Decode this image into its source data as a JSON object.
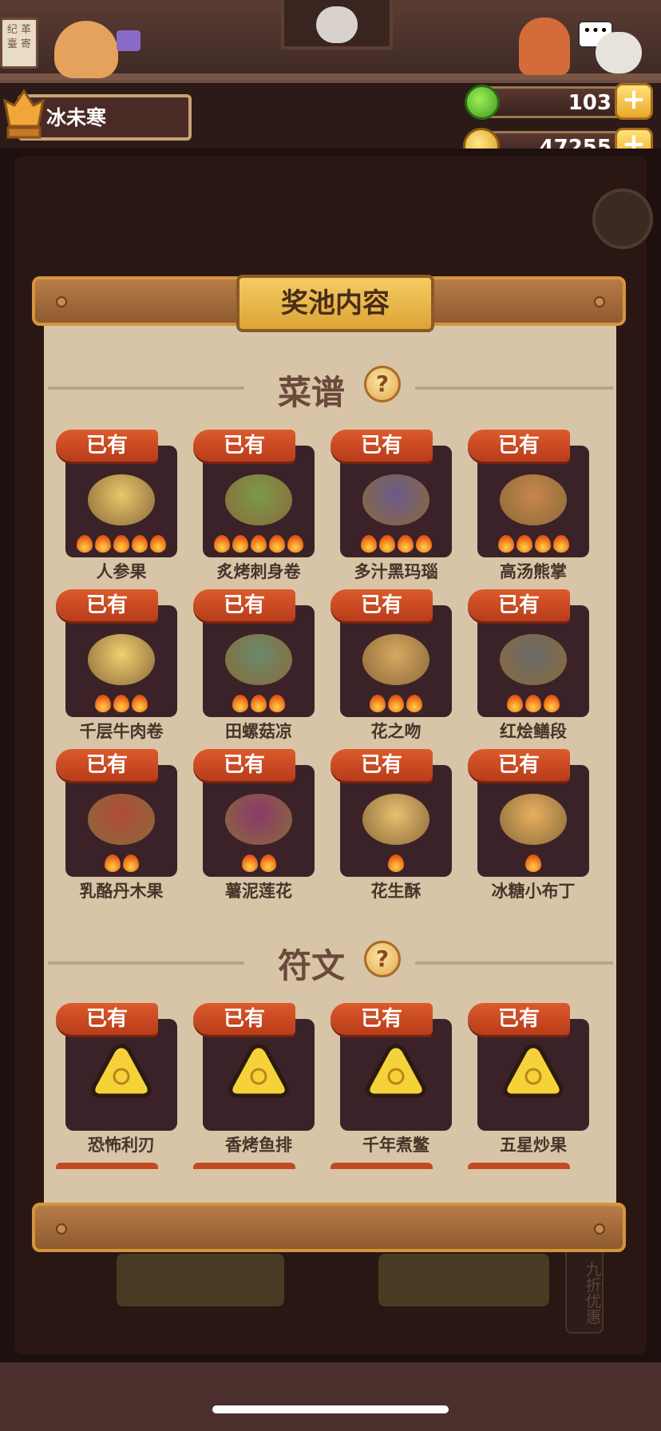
{
  "top_scene": {
    "sign_left": "纪 革\n臺 寄"
  },
  "player": {
    "name": "冰未寒"
  },
  "currency": {
    "gems": "103",
    "coins": "47255",
    "plus": "+"
  },
  "modal": {
    "title": "奖池内容",
    "owned_label": "已有",
    "question_mark": "?",
    "recipes_title": "菜谱",
    "runes_title": "符文",
    "recipes": [
      {
        "name": "人参果",
        "stars": 5,
        "art": "ginseng-fruit-icon"
      },
      {
        "name": "炙烤刺身卷",
        "stars": 5,
        "art": "grilled-roll-icon"
      },
      {
        "name": "多汁黑玛瑙",
        "stars": 4,
        "art": "black-agate-icon"
      },
      {
        "name": "高汤熊掌",
        "stars": 4,
        "art": "bear-paw-icon"
      },
      {
        "name": "千层牛肉卷",
        "stars": 3,
        "art": "beef-roll-icon"
      },
      {
        "name": "田螺菇凉",
        "stars": 3,
        "art": "snail-mushroom-icon"
      },
      {
        "name": "花之吻",
        "stars": 3,
        "art": "flower-kiss-icon"
      },
      {
        "name": "红烩鳝段",
        "stars": 3,
        "art": "eel-stew-icon"
      },
      {
        "name": "乳酪丹木果",
        "stars": 2,
        "art": "cheese-fruit-icon"
      },
      {
        "name": "薯泥莲花",
        "stars": 2,
        "art": "potato-lotus-icon"
      },
      {
        "name": "花生酥",
        "stars": 1,
        "art": "peanut-cake-icon"
      },
      {
        "name": "冰糖小布丁",
        "stars": 1,
        "art": "pudding-icon"
      }
    ],
    "runes": [
      {
        "name": "恐怖利刃",
        "art": "blade-rune-icon"
      },
      {
        "name": "香烤鱼排",
        "art": "fish-rune-icon"
      },
      {
        "name": "千年煮鳖",
        "art": "turtle-rune-icon"
      },
      {
        "name": "五星炒果",
        "art": "star-rune-icon"
      }
    ]
  },
  "background": {
    "right_tag": "九折优惠"
  }
}
